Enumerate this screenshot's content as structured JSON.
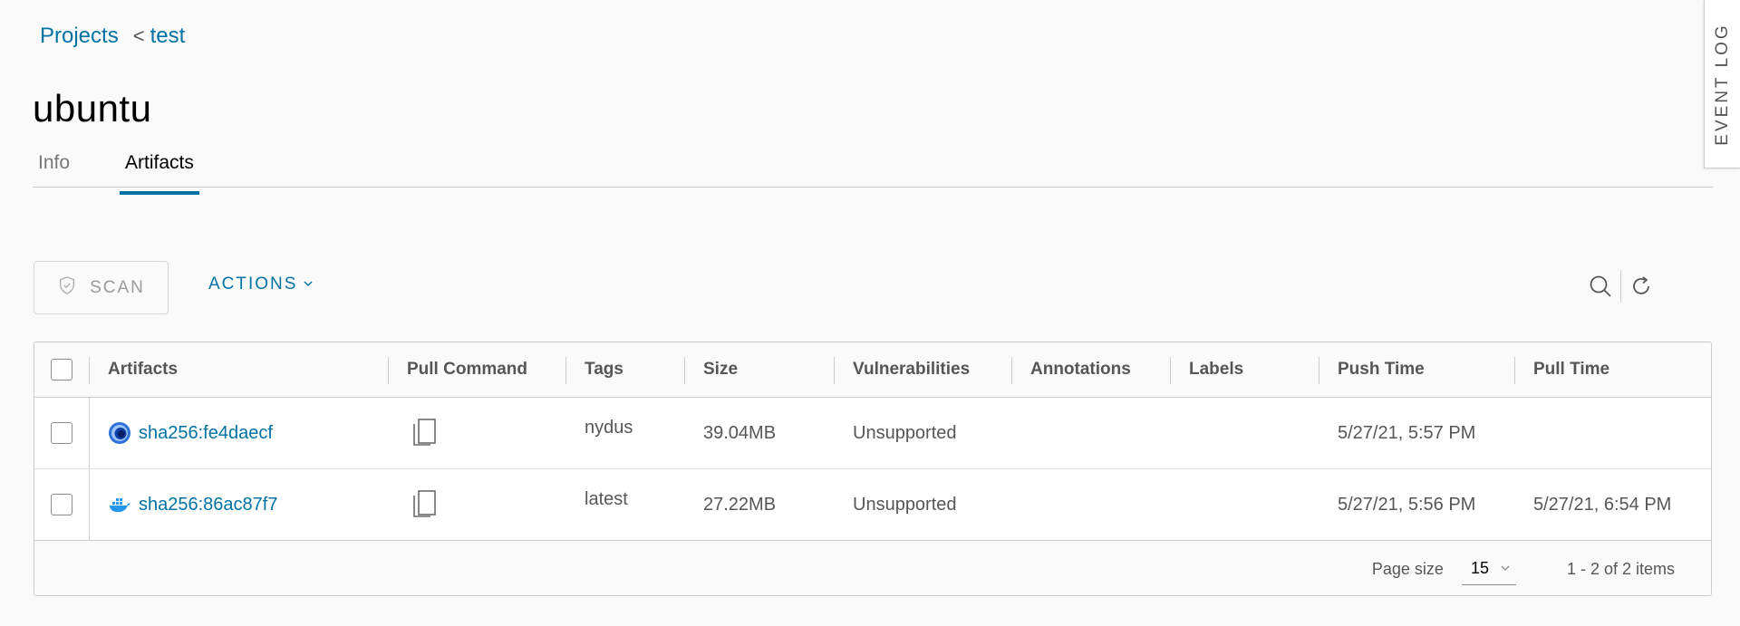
{
  "breadcrumb": {
    "projects": "Projects",
    "separator": "<",
    "project": "test"
  },
  "title": "ubuntu",
  "tabs": [
    {
      "label": "Info"
    },
    {
      "label": "Artifacts"
    }
  ],
  "event_log": "EVENT LOG",
  "toolbar": {
    "scan_label": "SCAN",
    "actions_label": "ACTIONS"
  },
  "grid": {
    "columns": [
      "Artifacts",
      "Pull Command",
      "Tags",
      "Size",
      "Vulnerabilities",
      "Annotations",
      "Labels",
      "Push Time",
      "Pull Time"
    ],
    "rows": [
      {
        "artifact": "sha256:fe4daecf",
        "icon": "nydus-icon",
        "tags": "nydus",
        "size": "39.04MB",
        "vulnerabilities": "Unsupported",
        "annotations": "",
        "labels": "",
        "push_time": "5/27/21, 5:57 PM",
        "pull_time": ""
      },
      {
        "artifact": "sha256:86ac87f7",
        "icon": "docker-icon",
        "tags": "latest",
        "size": "27.22MB",
        "vulnerabilities": "Unsupported",
        "annotations": "",
        "labels": "",
        "push_time": "5/27/21, 5:56 PM",
        "pull_time": "5/27/21, 6:54 PM"
      }
    ],
    "footer": {
      "page_size_label": "Page size",
      "page_size": "15",
      "count": "1 - 2 of 2 items"
    }
  },
  "colors": {
    "link": "#0072a3",
    "border": "#cccccc",
    "background": "#fafafa"
  }
}
